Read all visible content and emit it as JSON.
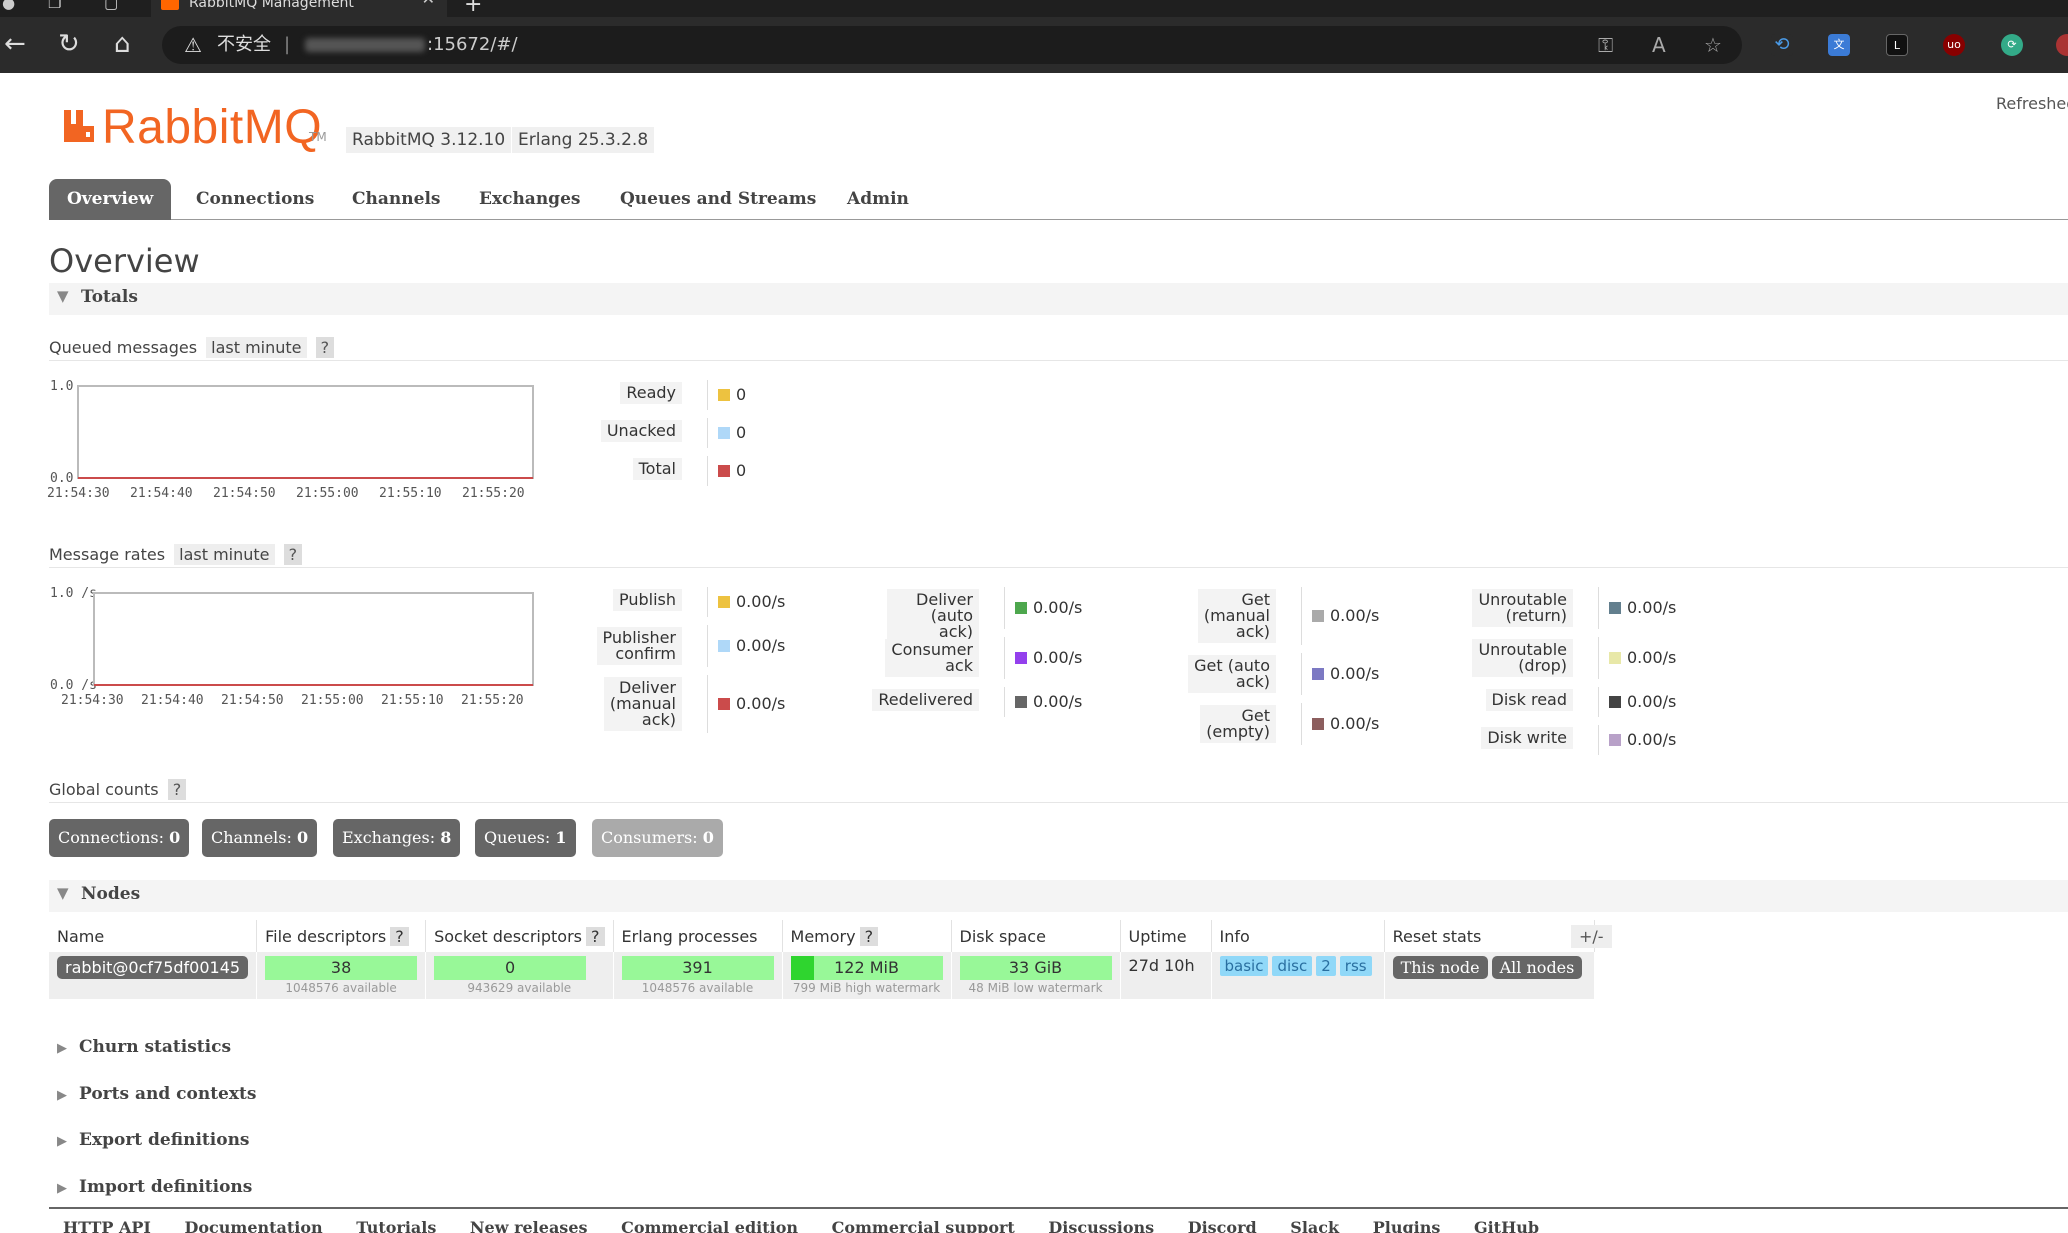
{
  "browser": {
    "tab_title": "RabbitMQ Management",
    "security_label": "不安全",
    "url_visible": ":15672/#/"
  },
  "header": {
    "logo_text": "RabbitMQ",
    "logo_tm": "TM",
    "rabbitmq_version": "RabbitMQ 3.12.10",
    "erlang_version": "Erlang 25.3.2.8",
    "refreshed_label": "Refreshed"
  },
  "nav_tabs": [
    {
      "label": "Overview",
      "active": true
    },
    {
      "label": "Connections"
    },
    {
      "label": "Channels"
    },
    {
      "label": "Exchanges"
    },
    {
      "label": "Queues and Streams"
    },
    {
      "label": "Admin"
    }
  ],
  "page_title": "Overview",
  "totals": {
    "section_label": "Totals",
    "queued": {
      "label": "Queued messages",
      "range": "last minute",
      "help": "?",
      "legend": [
        {
          "name": "Ready",
          "value": "0",
          "color": "#edc240"
        },
        {
          "name": "Unacked",
          "value": "0",
          "color": "#afd8f8"
        },
        {
          "name": "Total",
          "value": "0",
          "color": "#cb4b4b"
        }
      ]
    },
    "rates": {
      "label": "Message rates",
      "range": "last minute",
      "help": "?",
      "col1": [
        {
          "name": "Publish",
          "value": "0.00/s",
          "color": "#edc240"
        },
        {
          "name": "Publisher\nconfirm",
          "value": "0.00/s",
          "color": "#afd8f8"
        },
        {
          "name": "Deliver\n(manual\nack)",
          "value": "0.00/s",
          "color": "#cb4b4b"
        }
      ],
      "col2": [
        {
          "name": "Deliver\n(auto ack)",
          "value": "0.00/s",
          "color": "#4da74d"
        },
        {
          "name": "Consumer\nack",
          "value": "0.00/s",
          "color": "#9440ed"
        },
        {
          "name": "Redelivered",
          "value": "0.00/s",
          "color": "#666666"
        }
      ],
      "col3": [
        {
          "name": "Get\n(manual\nack)",
          "value": "0.00/s",
          "color": "#aaaaaa"
        },
        {
          "name": "Get (auto\nack)",
          "value": "0.00/s",
          "color": "#7c79c3"
        },
        {
          "name": "Get\n(empty)",
          "value": "0.00/s",
          "color": "#8c5e5e"
        }
      ],
      "col4": [
        {
          "name": "Unroutable\n(return)",
          "value": "0.00/s",
          "color": "#637f8e"
        },
        {
          "name": "Unroutable\n(drop)",
          "value": "0.00/s",
          "color": "#e8e8a8"
        },
        {
          "name": "Disk read",
          "value": "0.00/s",
          "color": "#444444"
        },
        {
          "name": "Disk write",
          "value": "0.00/s",
          "color": "#b8a1c8"
        }
      ]
    },
    "global_counts": {
      "label": "Global counts",
      "help": "?",
      "items": [
        {
          "label": "Connections:",
          "value": "0"
        },
        {
          "label": "Channels:",
          "value": "0"
        },
        {
          "label": "Exchanges:",
          "value": "8"
        },
        {
          "label": "Queues:",
          "value": "1"
        },
        {
          "label": "Consumers:",
          "value": "0"
        }
      ]
    }
  },
  "chart_data": [
    {
      "type": "line",
      "title": "Queued messages",
      "x": [
        "21:54:30",
        "21:54:40",
        "21:54:50",
        "21:55:00",
        "21:55:10",
        "21:55:20"
      ],
      "ytick_labels": [
        "1.0",
        "0.0"
      ],
      "ylim": [
        0,
        1
      ],
      "series": [
        {
          "name": "Ready",
          "values": [
            0,
            0,
            0,
            0,
            0,
            0
          ]
        },
        {
          "name": "Unacked",
          "values": [
            0,
            0,
            0,
            0,
            0,
            0
          ]
        },
        {
          "name": "Total",
          "values": [
            0,
            0,
            0,
            0,
            0,
            0
          ]
        }
      ]
    },
    {
      "type": "line",
      "title": "Message rates",
      "x": [
        "21:54:30",
        "21:54:40",
        "21:54:50",
        "21:55:00",
        "21:55:10",
        "21:55:20"
      ],
      "ytick_labels": [
        "1.0 /s",
        "0.0 /s"
      ],
      "ylim": [
        0,
        1
      ],
      "series": [
        {
          "name": "Publish",
          "values": [
            0,
            0,
            0,
            0,
            0,
            0
          ]
        }
      ]
    }
  ],
  "nodes": {
    "section_label": "Nodes",
    "plus_minus": "+/-",
    "columns": {
      "name": "Name",
      "file_desc": "File descriptors",
      "socket_desc": "Socket descriptors",
      "erlang_proc": "Erlang processes",
      "memory": "Memory",
      "disk": "Disk space",
      "uptime": "Uptime",
      "info": "Info",
      "reset": "Reset stats"
    },
    "help": "?",
    "row": {
      "name": "rabbit@0cf75df00145",
      "file_desc": "38",
      "file_desc_sub": "1048576 available",
      "socket_desc": "0",
      "socket_desc_sub": "943629 available",
      "erlang_proc": "391",
      "erlang_proc_sub": "1048576 available",
      "memory": "122 MiB",
      "memory_sub": "799 MiB high watermark",
      "memory_fill": 0.153,
      "disk": "33 GiB",
      "disk_sub": "48 MiB low watermark",
      "uptime": "27d 10h",
      "info_badges": [
        "basic",
        "disc",
        "2",
        "rss"
      ],
      "reset_this": "This node",
      "reset_all": "All nodes"
    }
  },
  "collapsed_sections": [
    "Churn statistics",
    "Ports and contexts",
    "Export definitions",
    "Import definitions"
  ],
  "footer_links": [
    "HTTP API",
    "Documentation",
    "Tutorials",
    "New releases",
    "Commercial edition",
    "Commercial support",
    "Discussions",
    "Discord",
    "Slack",
    "Plugins",
    "GitHub"
  ]
}
